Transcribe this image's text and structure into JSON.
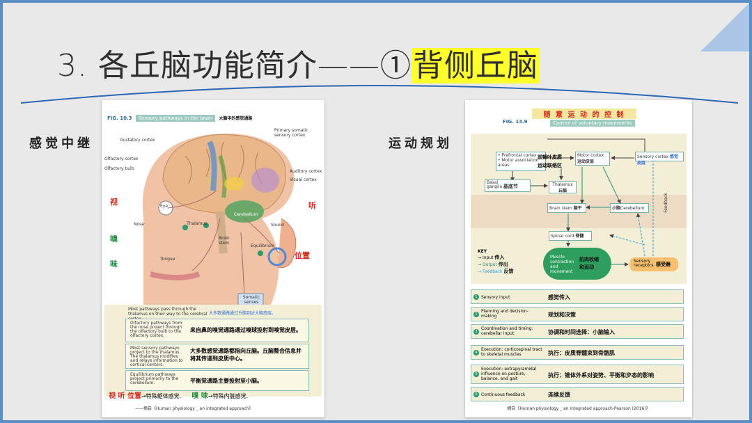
{
  "title": {
    "prefix": "3. 各丘脑功能简介——①",
    "highlight": "背侧丘脑"
  },
  "left_label": "感觉中继",
  "right_label": "运动规划",
  "fig1": {
    "fig_no": "FIG. 10.3",
    "caption_en": "Sensory pathways in the brain",
    "caption_zh": "大脑中的感觉通路",
    "labels": {
      "primary_somatic": "Primary somatic sensory cortex",
      "gustatory": "Gustatory cortex",
      "olfactory_cortex": "Olfactory cortex",
      "olfactory_bulb": "Olfactory bulb",
      "auditory": "Auditory cortex",
      "visual": "Visual cortex",
      "eye": "Eye",
      "nose": "Nose",
      "thalamus": "Thalamus",
      "cerebellum": "Cerebellum",
      "sound": "Sound",
      "brain_stem": "Brain stem",
      "equilibrium": "Equilibrium",
      "tongue": "Tongue",
      "somatic": "Somatic senses",
      "see": "视",
      "hear": "听",
      "smell": "嗅",
      "taste": "味",
      "position": "位置"
    },
    "note_en": "Most pathways pass through the thalamus on their way to the cerebral cortex.",
    "note_zh": "大多数通路通过丘脑到达大脑皮层。",
    "items": [
      {
        "n": "1",
        "en": "Olfactory pathways from the nose project through the olfactory bulb to the olfactory cortex.",
        "zh": "来自鼻的嗅觉通路通过嗅球投射到嗅觉皮层。"
      },
      {
        "n": "2",
        "en": "Most sensory pathways project to the thalamus. The thalamus modifies and relays information to cortical centers.",
        "zh": "大多数感觉通路都指向丘脑。丘脑整合信息并将其传递到皮质中心。"
      },
      {
        "n": "3",
        "en": "Equilibrium pathways project primarily to the cerebellum.",
        "zh": "平衡觉通路主要投射至小脑。"
      }
    ],
    "bottom_a": "视 听 位置",
    "bottom_a_tail": "→特殊躯体感觉.",
    "bottom_b": "嗅 味",
    "bottom_b_tail": "→特殊内脏感觉.",
    "source": "——摘自《Human physiology _ an integrated approach》"
  },
  "fig2": {
    "title_zh": "随 意 运 动 的 控 制",
    "fig_no": "FIG. 13.9",
    "caption_en": "Control of voluntary movements",
    "nodes": {
      "prefrontal": "• Prefrontal cortex\n• Motor association areas",
      "prefrontal_zh": "前额叶皮质\n运动联络区",
      "motor": "Motor cortex",
      "motor_zh": "运动皮层",
      "sensory": "Sensory cortex",
      "sensory_zh": "感觉皮层",
      "basal": "Basal ganglia",
      "basal_zh": "基底节",
      "thalamus": "Thalamus",
      "thalamus_zh": "丘脑",
      "brainstem": "Brain stem",
      "brainstem_zh": "脑干",
      "cerebellum": "Cerebellum",
      "cerebellum_zh": "小脑",
      "spinal": "Spinal cord",
      "spinal_zh": "脊髓",
      "muscle": "Muscle contraction and movement",
      "muscle_zh": "肌肉收缩\n和运动",
      "receptors": "Sensory receptors",
      "receptors_zh": "感受器",
      "feedback": "Feedback"
    },
    "key": {
      "title": "KEY",
      "input": "Input",
      "input_zh": "传入",
      "output": "Output",
      "output_zh": "传出",
      "feedback": "Feedback",
      "feedback_zh": "反馈"
    },
    "rows": [
      {
        "n": "1",
        "en": "Sensory input",
        "zh": "感觉传入"
      },
      {
        "n": "2",
        "en": "Planning and decision-making",
        "zh": "规划和决策"
      },
      {
        "n": "3",
        "en": "Coordination and timing: cerebellar input",
        "zh": "协调和时间选择：小脑输入"
      },
      {
        "n": "4",
        "en": "Execution: corticospinal tract to skeletal muscles",
        "zh": "执行：皮质脊髓束到骨骼肌"
      },
      {
        "n": "5",
        "en": "Execution: extrapyramidal influence on posture, balance, and gait",
        "zh": "执行：锥体外系对姿势、平衡和步态的影响"
      },
      {
        "n": "6",
        "en": "Continuous feedback",
        "zh": "连续反馈"
      }
    ],
    "source": "摘自《Human physiology _ an integrated approach-Pearson (2016)》"
  }
}
